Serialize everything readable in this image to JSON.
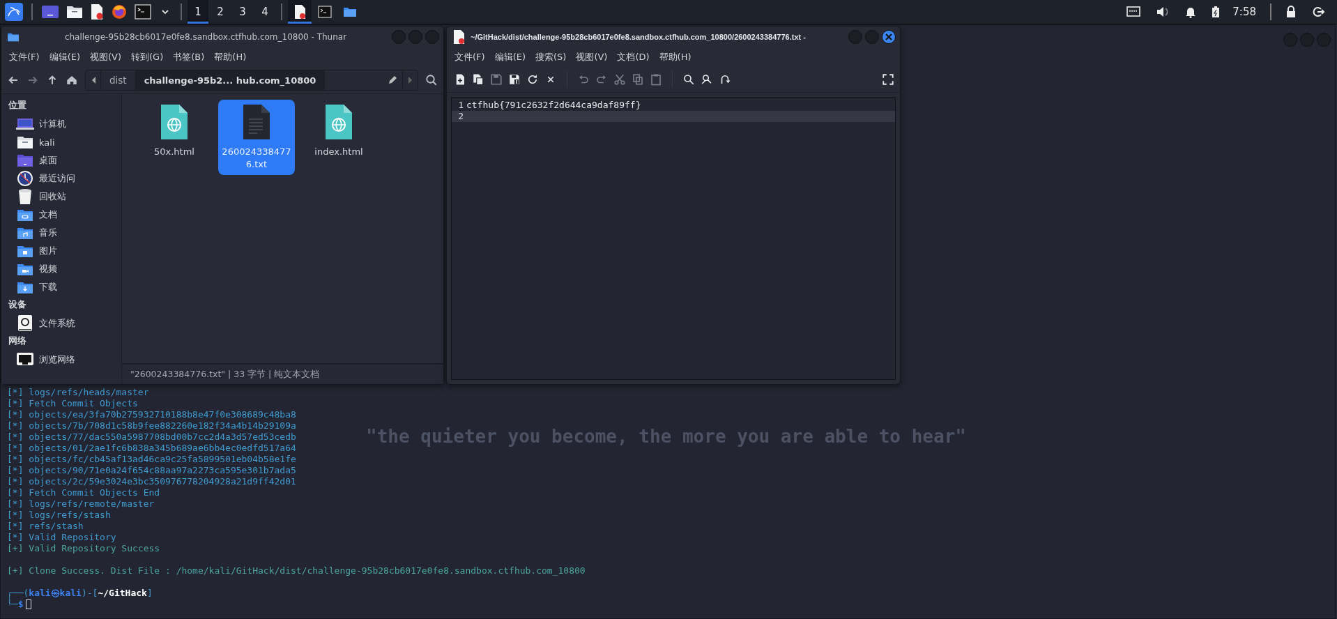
{
  "taskbar": {
    "workspaces": [
      {
        "label": "1",
        "selected": true
      },
      {
        "label": "2",
        "selected": false
      },
      {
        "label": "3",
        "selected": false
      },
      {
        "label": "4",
        "selected": false
      }
    ],
    "tasks": [
      {
        "kind": "editor",
        "selected": true
      },
      {
        "kind": "terminal",
        "selected": false
      },
      {
        "kind": "folder",
        "selected": false
      }
    ],
    "clock": "7:58"
  },
  "file_manager": {
    "title": "challenge-95b28cb6017e0fe8.sandbox.ctfhub.com_10800 - Thunar",
    "menu": [
      "文件(F)",
      "编辑(E)",
      "视图(V)",
      "转到(G)",
      "书签(B)",
      "帮助(H)"
    ],
    "path": [
      {
        "label": "dist",
        "selected": false
      },
      {
        "label": "challenge-95b2... hub.com_10800",
        "selected": true
      }
    ],
    "sidebar": [
      {
        "heading": "位置",
        "items": [
          {
            "label": "计算机",
            "kind": "computer"
          },
          {
            "label": "kali",
            "kind": "home"
          },
          {
            "label": "桌面",
            "kind": "desktop"
          },
          {
            "label": "最近访问",
            "kind": "recent"
          },
          {
            "label": "回收站",
            "kind": "trash"
          },
          {
            "label": "文档",
            "kind": "documents"
          },
          {
            "label": "音乐",
            "kind": "music"
          },
          {
            "label": "图片",
            "kind": "pictures"
          },
          {
            "label": "视频",
            "kind": "videos"
          },
          {
            "label": "下载",
            "kind": "downloads"
          }
        ]
      },
      {
        "heading": "设备",
        "items": [
          {
            "label": "文件系统",
            "kind": "drive"
          }
        ]
      },
      {
        "heading": "网络",
        "items": [
          {
            "label": "浏览网络",
            "kind": "network"
          }
        ]
      }
    ],
    "files": [
      {
        "name": "50x.html",
        "kind": "html",
        "selected": false
      },
      {
        "name": "2600243384776.txt",
        "kind": "text",
        "selected": true
      },
      {
        "name": "index.html",
        "kind": "html",
        "selected": false
      }
    ],
    "status_bar": "\"2600243384776.txt\" | 33 字节 | 纯文本文档"
  },
  "editor": {
    "title": "~/GitHack/dist/challenge-95b28cb6017e0fe8.sandbox.ctfhub.com_10800/2600243384776.txt -",
    "menu": [
      "文件(F)",
      "编辑(E)",
      "搜索(S)",
      "视图(V)",
      "文档(D)",
      "帮助(H)"
    ],
    "toolbar": [
      {
        "buttons": [
          {
            "kind": "new",
            "disabled": false
          },
          {
            "kind": "new-window",
            "disabled": false
          },
          {
            "kind": "save",
            "disabled": true
          },
          {
            "kind": "save-as",
            "disabled": false
          },
          {
            "kind": "reload",
            "disabled": false
          },
          {
            "kind": "close",
            "disabled": false
          }
        ]
      },
      {
        "buttons": [
          {
            "kind": "undo",
            "disabled": true
          },
          {
            "kind": "redo",
            "disabled": true
          },
          {
            "kind": "cut",
            "disabled": true
          },
          {
            "kind": "copy",
            "disabled": true
          },
          {
            "kind": "paste",
            "disabled": true
          }
        ]
      },
      {
        "buttons": [
          {
            "kind": "find",
            "disabled": false
          },
          {
            "kind": "replace",
            "disabled": false
          },
          {
            "kind": "goto",
            "disabled": false
          }
        ]
      }
    ],
    "lines": [
      {
        "number": "1",
        "text": "ctfhub{791c2632f2d644ca9daf89ff}",
        "current": false
      },
      {
        "number": "2",
        "current": true
      }
    ]
  },
  "terminal": {
    "lines": [
      {
        "kind": "info",
        "text": "[*] logs/refs/heads/master"
      },
      {
        "kind": "info",
        "text": "[*] Fetch Commit Objects"
      },
      {
        "kind": "info",
        "text": "[*] objects/ea/3fa70b275932710188b8e47f0e308689c48ba8"
      },
      {
        "kind": "info",
        "text": "[*] objects/7b/708d1c58b9fee882260e182f34a4b14b29109a"
      },
      {
        "kind": "info",
        "text": "[*] objects/77/dac550a5987708bd00b7cc2d4a3d57ed53cedb"
      },
      {
        "kind": "info",
        "text": "[*] objects/01/2ae1fc6b838a345b689ae6bb4ec0edfd517a64"
      },
      {
        "kind": "info",
        "text": "[*] objects/fc/cb45af13ad46ca9c25fa5899501eb04b58e1fe"
      },
      {
        "kind": "info",
        "text": "[*] objects/90/71e0a24f654c88aa97a2273ca595e301b7ada5"
      },
      {
        "kind": "info",
        "text": "[*] objects/2c/59e3024e3bc350976778204928a21d9ff42d01"
      },
      {
        "kind": "info",
        "text": "[*] Fetch Commit Objects End"
      },
      {
        "kind": "info",
        "text": "[*] logs/refs/remote/master"
      },
      {
        "kind": "info",
        "text": "[*] logs/refs/stash"
      },
      {
        "kind": "info",
        "text": "[*] refs/stash"
      },
      {
        "kind": "info",
        "text": "[*] Valid Repository"
      },
      {
        "kind": "success",
        "text": "[+] Valid Repository Success"
      },
      {
        "kind": "blank"
      },
      {
        "kind": "success",
        "text": "[+] Clone Success. Dist File : /home/kali/GitHack/dist/challenge-95b28cb6017e0fe8.sandbox.ctfhub.com_10800"
      },
      {
        "kind": "blank"
      }
    ],
    "prompt": [
      [
        {
          "kind": "frame",
          "text": "┌──("
        },
        {
          "kind": "user",
          "text": "kali㉿kali"
        },
        {
          "kind": "frame",
          "text": ")-["
        },
        {
          "kind": "path",
          "text": "~/GitHack"
        },
        {
          "kind": "frame",
          "text": "]"
        }
      ],
      [
        {
          "kind": "frame",
          "text": "└─"
        },
        {
          "kind": "symbol",
          "text": "$"
        }
      ]
    ]
  },
  "wallpaper": {
    "slogan": "\"the quieter you become, the more you are able to hear\""
  }
}
